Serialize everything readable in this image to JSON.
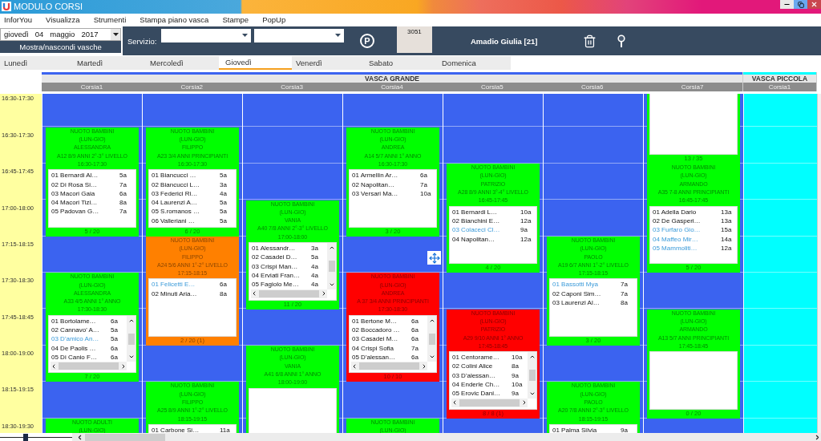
{
  "window": {
    "title": "MODULO CORSI"
  },
  "menu": [
    "InforYou",
    "Visualizza",
    "Strumenti",
    "Stampa piano vasca",
    "Stampe",
    "PopUp"
  ],
  "date_picker": {
    "parts": [
      "giovedì",
      "04",
      "maggio",
      "2017"
    ]
  },
  "toggle_button": "Mostra/nascondi vasche",
  "service": {
    "label": "Servizio:",
    "badge": "P"
  },
  "user": {
    "code": "3051",
    "name": "Amadio Giulia [21]"
  },
  "day_tabs": [
    {
      "label": "Lunedì",
      "selected": false
    },
    {
      "label": "Martedì",
      "selected": false
    },
    {
      "label": "Mercoledì",
      "selected": false
    },
    {
      "label": "Giovedì",
      "selected": true
    },
    {
      "label": "Venerdì",
      "selected": false
    },
    {
      "label": "Sabato",
      "selected": false
    },
    {
      "label": "Domenica",
      "selected": false
    }
  ],
  "times": [
    "16:30-17:30",
    "16:30-17:30",
    "16:45-17:45",
    "17:00-18:00",
    "17:15-18:15",
    "17:30-18:30",
    "17:45-18:45",
    "18:00-19:00",
    "18:15-19:15",
    "18:30-19:30"
  ],
  "pools": [
    {
      "name": "VASCA GRANDE",
      "color": "#3b63f0",
      "lanes": [
        {
          "name": "Corsia1",
          "slots": [
            {
              "kind": "gap"
            },
            {
              "kind": "course",
              "color": "#00ff00",
              "title": "NUOTO BAMBINI",
              "days": "(LUN-GIO)",
              "instructor": "ALESSANDRA",
              "group": "A12 8/9 ANNI 2°-3° LIVELLO",
              "time": "16:30-17:30",
              "scroll": false,
              "count": "5 / 20",
              "students": [
                {
                  "name": "01 Bernardi Al…",
                  "age": "5a",
                  "highlighted": false
                },
                {
                  "name": "02 Di Rosa Si…",
                  "age": "7a",
                  "highlighted": false
                },
                {
                  "name": "03 Macori Gaia",
                  "age": "6a",
                  "highlighted": false
                },
                {
                  "name": "04 Macori Tizi…",
                  "age": "8a",
                  "highlighted": false
                },
                {
                  "name": "05 Padovan G…",
                  "age": "7a",
                  "highlighted": false
                }
              ]
            },
            {
              "kind": "gap"
            },
            {
              "kind": "course",
              "color": "#00ff00",
              "title": "NUOTO BAMBINI",
              "days": "(LUN-GIO)",
              "instructor": "ALESSANDRA",
              "group": "A33 4/5 ANNI 1° ANNO",
              "time": "17:30-18:30",
              "scroll": true,
              "count": "7 / 20",
              "students": [
                {
                  "name": "01 Bortolame…",
                  "age": "6a",
                  "highlighted": false
                },
                {
                  "name": "02 Cannavo' A…",
                  "age": "5a",
                  "highlighted": false
                },
                {
                  "name": "03 D'amico An…",
                  "age": "5a",
                  "highlighted": true
                },
                {
                  "name": "04 De Paolis …",
                  "age": "6a",
                  "highlighted": false
                },
                {
                  "name": "05 Di Canio F…",
                  "age": "6a",
                  "highlighted": false
                }
              ]
            },
            {
              "kind": "gap"
            },
            {
              "kind": "course",
              "color": "#00ff00",
              "title": "NUOTO ADULTI",
              "days": "(LUN-GIO)",
              "scroll": false
            }
          ]
        },
        {
          "name": "Corsia2",
          "slots": [
            {
              "kind": "gap"
            },
            {
              "kind": "course",
              "color": "#00ff00",
              "title": "NUOTO BAMBINI",
              "days": "(LUN-GIO)",
              "instructor": "FILIPPO",
              "group": "A23 3/4 ANNI PRINCIPIANTI",
              "time": "16:30-17:30",
              "scroll": false,
              "count": "6 / 20",
              "students": [
                {
                  "name": "01 Biancucci …",
                  "age": "5a",
                  "highlighted": false
                },
                {
                  "name": "02 Biancucci L…",
                  "age": "3a",
                  "highlighted": false
                },
                {
                  "name": "03 Federici Ri…",
                  "age": "4a",
                  "highlighted": false
                },
                {
                  "name": "04 Laurenzi A…",
                  "age": "5a",
                  "highlighted": false
                },
                {
                  "name": "05 S.romanos …",
                  "age": "5a",
                  "highlighted": false
                },
                {
                  "name": "06 Valleriani …",
                  "age": "5a",
                  "highlighted": false
                }
              ]
            },
            {
              "kind": "course",
              "color": "#ff8000",
              "title": "NUOTO BAMBINI",
              "days": "(LUN-GIO)",
              "instructor": "FILIPPO",
              "group": "A24 5/6 ANNI 1°-2° LIVELLO",
              "time": "17:15-18:15",
              "scroll": false,
              "count": "2 / 20 (1)",
              "students": [
                {
                  "name": "01 Felicetti E…",
                  "age": "6a",
                  "highlighted": true
                },
                {
                  "name": "02 Minuti Aria…",
                  "age": "8a",
                  "highlighted": false
                }
              ]
            },
            {
              "kind": "gap"
            },
            {
              "kind": "course",
              "color": "#00ff00",
              "title": "NUOTO BAMBINI",
              "days": "(LUN-GIO)",
              "instructor": "FILIPPO",
              "group": "A25 8/9 ANNI 1°-2° LIVELLO",
              "time": "18:15-19:15",
              "scroll": false,
              "students": [
                {
                  "name": "01 Carbone Si…",
                  "age": "11a",
                  "highlighted": false
                }
              ]
            }
          ]
        },
        {
          "name": "Corsia3",
          "slots": [
            {
              "kind": "gap"
            },
            {
              "kind": "gap"
            },
            {
              "kind": "gap"
            },
            {
              "kind": "course",
              "color": "#00ff00",
              "title": "NUOTO BAMBINI",
              "days": "(LUN-GIO)",
              "instructor": "VANIA",
              "group": "A40 7/8 ANNI 2°-3° LIVELLO",
              "time": "17:00-18:00",
              "scroll": true,
              "count": "11 / 20",
              "students": [
                {
                  "name": "01 Alessandr…",
                  "age": "3a",
                  "highlighted": false
                },
                {
                  "name": "02 Casadei D…",
                  "age": "5a",
                  "highlighted": false
                },
                {
                  "name": "03 Crispi Man…",
                  "age": "4a",
                  "highlighted": false
                },
                {
                  "name": "04 Erviati Fran…",
                  "age": "4a",
                  "highlighted": false
                },
                {
                  "name": "05 Fagiolo Me…",
                  "age": "4a",
                  "highlighted": false
                }
              ]
            },
            {
              "kind": "gap"
            },
            {
              "kind": "course",
              "color": "#00ff00",
              "title": "NUOTO BAMBINI",
              "days": "(LUN-GIO)",
              "instructor": "VANIA",
              "group": "A41 6/8 ANNI 1° ANNO",
              "time": "18:00-19:00",
              "scroll": false
            }
          ]
        },
        {
          "name": "Corsia4",
          "slots": [
            {
              "kind": "gap"
            },
            {
              "kind": "course",
              "color": "#00ff00",
              "title": "NUOTO BAMBINI",
              "days": "(LUN-GIO)",
              "instructor": "ANDREA",
              "group": "A14 5/7 ANNI 1° ANNO",
              "time": "16:30-17:30",
              "scroll": false,
              "count": "3 / 20",
              "students": [
                {
                  "name": "01 Armellin Ar…",
                  "age": "6a",
                  "highlighted": false
                },
                {
                  "name": "02 Napolitan…",
                  "age": "7a",
                  "highlighted": false
                },
                {
                  "name": "03 Versari Ma…",
                  "age": "10a",
                  "highlighted": false
                }
              ]
            },
            {
              "kind": "gap"
            },
            {
              "kind": "course",
              "color": "#ff0000",
              "title": "NUOTO BAMBINI",
              "days": "(LUN-GIO)",
              "instructor": "ANDREA",
              "group": "A 37 3/4 ANNI PRINCIPIANTI",
              "time": "17:30-18:30",
              "scroll": true,
              "count": "10 / 10",
              "students": [
                {
                  "name": "01 Bertone M…",
                  "age": "6a",
                  "highlighted": false
                },
                {
                  "name": "02 Boccadoro …",
                  "age": "6a",
                  "highlighted": false
                },
                {
                  "name": "03 Casadei M…",
                  "age": "6a",
                  "highlighted": false
                },
                {
                  "name": "04 Crispi Sofia",
                  "age": "7a",
                  "highlighted": false
                },
                {
                  "name": "05 D'alessan…",
                  "age": "6a",
                  "highlighted": false
                }
              ]
            },
            {
              "kind": "gap"
            },
            {
              "kind": "course",
              "color": "#00ff00",
              "title": "NUOTO BAMBINI",
              "days": "(LUN-GIO)",
              "scroll": false
            }
          ]
        },
        {
          "name": "Corsia5",
          "slots": [
            {
              "kind": "gap"
            },
            {
              "kind": "gap"
            },
            {
              "kind": "course",
              "color": "#00ff00",
              "title": "NUOTO BAMBINI",
              "days": "(LUN-GIO)",
              "instructor": "PATRIZIO",
              "group": "A28 8/9 ANNI 3°-4° LIVELLO",
              "time": "16:45-17:45",
              "scroll": false,
              "count": "4 / 20",
              "students": [
                {
                  "name": "01 Bernardi L…",
                  "age": "10a",
                  "highlighted": false
                },
                {
                  "name": "02 Bianchini E…",
                  "age": "12a",
                  "highlighted": false
                },
                {
                  "name": "03 Colaceci Cl…",
                  "age": "9a",
                  "highlighted": true
                },
                {
                  "name": "04 Napolitan…",
                  "age": "12a",
                  "highlighted": false
                }
              ]
            },
            {
              "kind": "gap"
            },
            {
              "kind": "course",
              "color": "#ff0000",
              "title": "NUOTO BAMBINI",
              "days": "(LUN-GIO)",
              "instructor": "PATRIZIO",
              "group": "A29 9/10 ANNI 1° ANNO",
              "time": "17:45-18:45",
              "scroll": true,
              "count": "8 / 8 (1)",
              "students": [
                {
                  "name": "01 Centorame…",
                  "age": "10a",
                  "highlighted": false
                },
                {
                  "name": "02 Colini Alice",
                  "age": "8a",
                  "highlighted": false
                },
                {
                  "name": "03 D'alessan…",
                  "age": "9a",
                  "highlighted": false
                },
                {
                  "name": "04 Enderle Ch…",
                  "age": "10a",
                  "highlighted": false
                },
                {
                  "name": "05 Erovic Dani…",
                  "age": "9a",
                  "highlighted": false
                }
              ]
            },
            {
              "kind": "gap"
            }
          ]
        },
        {
          "name": "Corsia6",
          "slots": [
            {
              "kind": "gap"
            },
            {
              "kind": "gap"
            },
            {
              "kind": "gap"
            },
            {
              "kind": "gap"
            },
            {
              "kind": "course",
              "color": "#00ff00",
              "title": "NUOTO BAMBINI",
              "days": "(LUN-GIO)",
              "instructor": "PAOLO",
              "group": "A19 6/7 ANNI 1°-2° LIVELLO",
              "time": "17:15-18:15",
              "scroll": false,
              "count": "3 / 20",
              "students": [
                {
                  "name": "01 Bassotti Mya",
                  "age": "7a",
                  "highlighted": true
                },
                {
                  "name": "02 Caponi Sim…",
                  "age": "7a",
                  "highlighted": false
                },
                {
                  "name": "03 Laurenzi Al…",
                  "age": "8a",
                  "highlighted": false
                }
              ]
            },
            {
              "kind": "gap"
            },
            {
              "kind": "course",
              "color": "#00ff00",
              "title": "NUOTO BAMBINI",
              "days": "(LUN-GIO)",
              "instructor": "PAOLO",
              "group": "A20 7/8 ANNI 2°-3° LIVELLO",
              "time": "18:15-19:15",
              "scroll": false,
              "students": [
                {
                  "name": "01 Palma Silvia",
                  "age": "9a",
                  "highlighted": false
                }
              ]
            }
          ]
        },
        {
          "name": "Corsia7",
          "slots": [
            {
              "kind": "tail",
              "color": "#00ff00",
              "count": "13 / 35"
            },
            {
              "kind": "course",
              "color": "#00ff00",
              "title": "NUOTO BAMBINI",
              "days": "(LUN-GIO)",
              "instructor": "ARMANDO",
              "group": "A35 7-8 ANNI PRINCIPIANTI",
              "time": "16:45-17:45",
              "scroll": false,
              "count": "5 / 20",
              "students": [
                {
                  "name": "01 Adella Dario",
                  "age": "13a",
                  "highlighted": false
                },
                {
                  "name": "02 De Gasperi…",
                  "age": "13a",
                  "highlighted": false
                },
                {
                  "name": "03 Furfaro Gio…",
                  "age": "15a",
                  "highlighted": true
                },
                {
                  "name": "04 Maffeo Mir…",
                  "age": "14a",
                  "highlighted": true
                },
                {
                  "name": "05 Mammoliti…",
                  "age": "12a",
                  "highlighted": true
                }
              ]
            },
            {
              "kind": "gap"
            },
            {
              "kind": "course",
              "color": "#00ff00",
              "title": "NUOTO BAMBINI",
              "days": "(LUN-GIO)",
              "instructor": "ARMANDO",
              "group": "A13 5/7 ANNI PRINCIPIANTI",
              "time": "17:45-18:45",
              "scroll": false,
              "count": "0 / 20"
            },
            {
              "kind": "gap"
            }
          ]
        }
      ]
    },
    {
      "name": "VASCA PICCOLA",
      "color": "#00ffff",
      "lanes": [
        {
          "name": "Corsia1"
        }
      ]
    }
  ],
  "zoom_slider": {
    "level": 0.36
  }
}
